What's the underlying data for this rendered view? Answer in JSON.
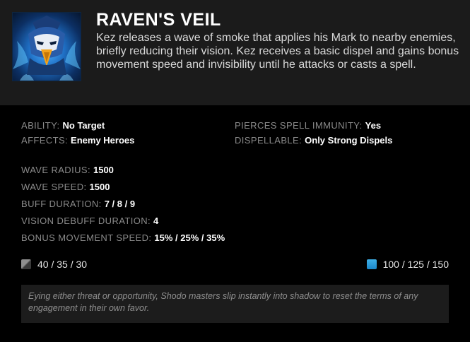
{
  "ability": {
    "name": "RAVEN'S VEIL",
    "icon": "raven-mask-icon",
    "description": "Kez releases a wave of smoke that applies his Mark to nearby enemies, briefly reducing their vision. Kez receives a basic dispel and gains bonus movement speed and invisibility until he attacks or casts a spell."
  },
  "properties": [
    {
      "label": "ABILITY:",
      "value": "No Target"
    },
    {
      "label": "AFFECTS:",
      "value": "Enemy Heroes"
    },
    {
      "label": "PIERCES SPELL IMMUNITY:",
      "value": "Yes"
    },
    {
      "label": "DISPELLABLE:",
      "value": "Only Strong Dispels"
    }
  ],
  "stats": [
    {
      "label": "WAVE RADIUS:",
      "value": "1500"
    },
    {
      "label": "WAVE SPEED:",
      "value": "1500"
    },
    {
      "label": "BUFF DURATION:",
      "value": "7 / 8 / 9"
    },
    {
      "label": "VISION DEBUFF DURATION:",
      "value": "4"
    },
    {
      "label": "BONUS MOVEMENT SPEED:",
      "value": "15% / 25% / 35%"
    }
  ],
  "cooldown": {
    "icon": "cooldown-icon",
    "value": "40 / 35 / 30"
  },
  "mana": {
    "icon": "mana-icon",
    "value": "100 / 125 / 150"
  },
  "lore": "Eying either threat or opportunity, Shodo masters slip instantly into shadow to reset the terms of any engagement in their own favor.",
  "colors": {
    "header_bg": "#1b1b1b",
    "body_bg": "#000000",
    "label": "#8a8a8a",
    "value": "#ffffff",
    "mana": "#1a86c9",
    "lore_bg": "#1c1c1c"
  }
}
